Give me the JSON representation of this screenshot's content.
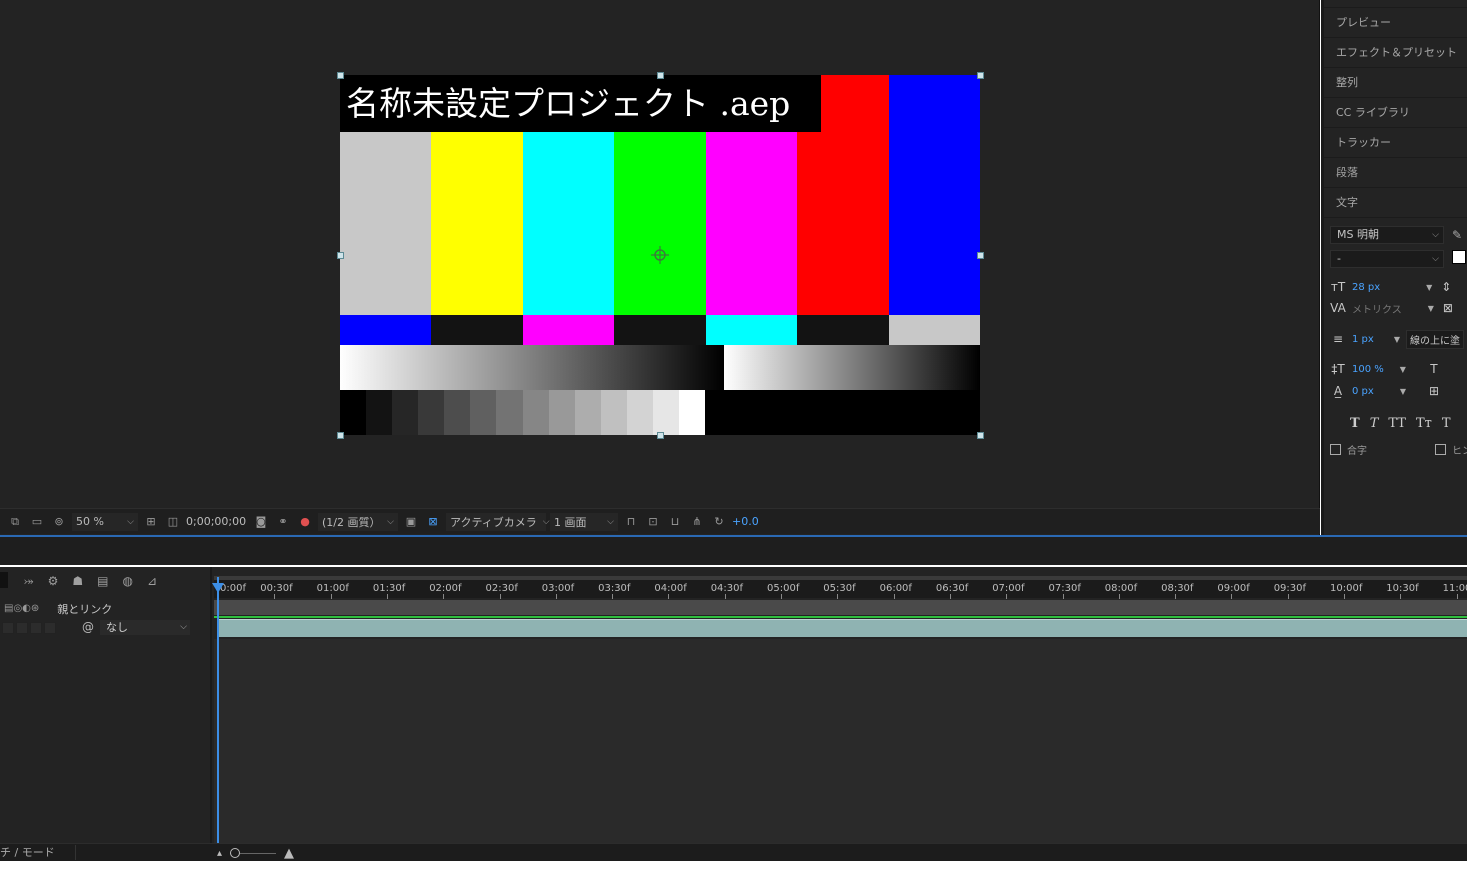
{
  "composition": {
    "title": "名称未設定プロジェクト .aep",
    "top_bars": [
      "#c8c8c8",
      "#ffff00",
      "#00ffff",
      "#00ff00",
      "#ff00ff",
      "#ff0000",
      "#0000ff"
    ],
    "mid_bars": [
      "#0000ff",
      "#131313",
      "#ff00ff",
      "#131313",
      "#00ffff",
      "#131313",
      "#c8c8c8"
    ],
    "steps": [
      "#000000",
      "#131313",
      "#262626",
      "#393939",
      "#4d4d4d",
      "#606060",
      "#737373",
      "#868686",
      "#999999",
      "#adadad",
      "#c0c0c0",
      "#d3d3d3",
      "#e6e6e6",
      "#ffffff"
    ]
  },
  "viewer_toolbar": {
    "zoom": "50 %",
    "timecode": "0;00;00;00",
    "resolution": "(1/2 画質）",
    "camera": "アクティブカメラ",
    "views": "1 画面",
    "exposure": "+0.0"
  },
  "right_panel": {
    "items": [
      "プレビュー",
      "エフェクト＆プリセット",
      "整列",
      "CC ライブラリ",
      "トラッカー",
      "段落",
      "文字"
    ]
  },
  "character": {
    "font": "MS 明朝",
    "style": "-",
    "size": "28 px",
    "kerning": "メトリクス",
    "stroke_width": "1 px",
    "stroke_mode": "線の上に塗",
    "vscale": "100 %",
    "baseline": "0 px",
    "style_buttons": [
      "T",
      "T",
      "TT",
      "Tт",
      "T"
    ],
    "ligature_label": "合字",
    "hindi_label": "ヒン"
  },
  "timeline": {
    "parent_link_label": "親とリンク",
    "parent_value": "なし",
    "ticks": [
      "0:00f",
      "00:30f",
      "01:00f",
      "01:30f",
      "02:00f",
      "02:30f",
      "03:00f",
      "03:30f",
      "04:00f",
      "04:30f",
      "05:00f",
      "05:30f",
      "06:00f",
      "06:30f",
      "07:00f",
      "07:30f",
      "08:00f",
      "08:30f",
      "09:00f",
      "09:30f",
      "10:00f",
      "10:30f",
      "11:00"
    ],
    "mode_label": "チ / モード"
  }
}
